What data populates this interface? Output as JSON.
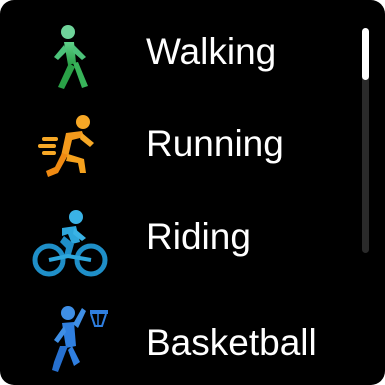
{
  "activities": [
    {
      "label": "Walking",
      "icon": "walking-figure-icon",
      "color": "#3fbf5a"
    },
    {
      "label": "Running",
      "icon": "running-figure-icon",
      "color": "#f59a1c"
    },
    {
      "label": "Riding",
      "icon": "cycling-figure-icon",
      "color": "#2ea7dc"
    },
    {
      "label": "Basketball",
      "icon": "basketball-figure-icon",
      "color": "#2f7fe0"
    }
  ],
  "scrollbar": {
    "position": 0.0
  }
}
